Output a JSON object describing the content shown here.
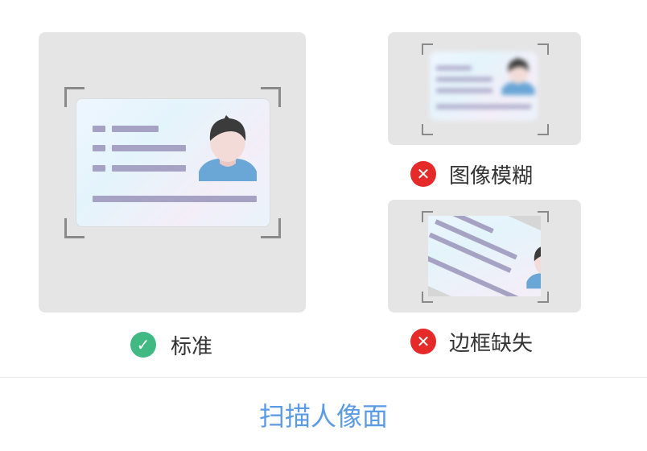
{
  "examples": {
    "standard": {
      "label": "标准",
      "status": "ok",
      "icon": "check-icon",
      "color": "#40b983"
    },
    "blurry": {
      "label": "图像模糊",
      "status": "error",
      "icon": "close-icon",
      "color": "#e52a2a"
    },
    "missing_border": {
      "label": "边框缺失",
      "status": "error",
      "icon": "close-icon",
      "color": "#e52a2a"
    }
  },
  "action": {
    "label": "扫描人像面",
    "color": "#5b9be6"
  }
}
